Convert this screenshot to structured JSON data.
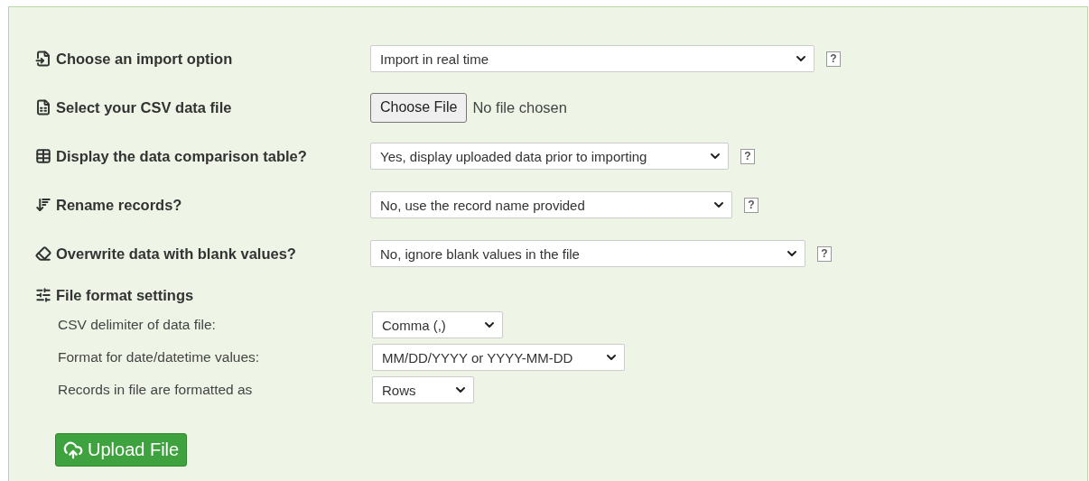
{
  "options": [
    {
      "kind": "select",
      "label": "Choose an import option",
      "value": "Import in real time",
      "help": "?"
    },
    {
      "kind": "file",
      "label": "Select your CSV data file",
      "button": "Choose File",
      "status": "No file chosen"
    },
    {
      "kind": "select",
      "label": "Display the data comparison table?",
      "value": "Yes, display uploaded data prior to importing",
      "help": "?"
    },
    {
      "kind": "select",
      "label": "Rename records?",
      "value": "No, use the record name provided",
      "help": "?"
    },
    {
      "kind": "select",
      "label": "Overwrite data with blank values?",
      "value": "No, ignore blank values in the file",
      "help": "?"
    }
  ],
  "format_settings": {
    "title": "File format settings",
    "rows": [
      {
        "label": "CSV delimiter of data file:",
        "value": "Comma (,)"
      },
      {
        "label": "Format for date/datetime values:",
        "value": "MM/DD/YYYY or YYYY-MM-DD"
      },
      {
        "label": "Records in file are formatted as",
        "value": "Rows"
      }
    ]
  },
  "upload_button": "Upload File"
}
